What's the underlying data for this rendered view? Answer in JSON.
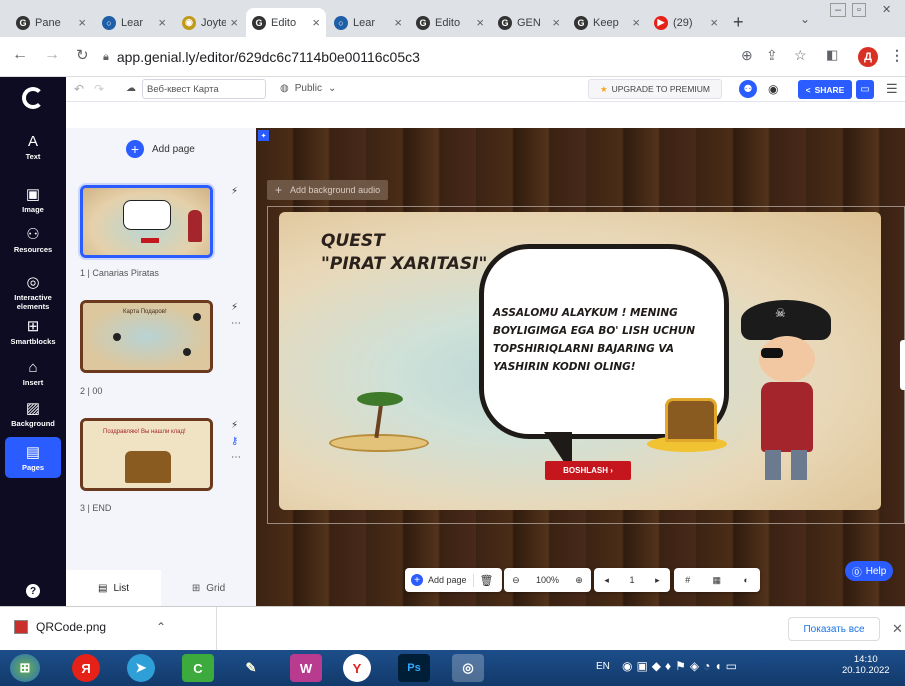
{
  "browser": {
    "tabs": [
      {
        "title": "Pane",
        "color": "#333333",
        "glyph": "G"
      },
      {
        "title": "Lear",
        "color": "#1f5fa8",
        "glyph": "○"
      },
      {
        "title": "Joyte",
        "color": "#c29a1a",
        "glyph": "◉"
      },
      {
        "title": "Edito",
        "color": "#333333",
        "glyph": "G",
        "active": true
      },
      {
        "title": "Lear",
        "color": "#1f5fa8",
        "glyph": "○"
      },
      {
        "title": "Edito",
        "color": "#333333",
        "glyph": "G"
      },
      {
        "title": "GEN",
        "color": "#333333",
        "glyph": "G"
      },
      {
        "title": "Keep",
        "color": "#333333",
        "glyph": "G"
      },
      {
        "title": "(29)",
        "color": "#e62117",
        "glyph": "▶"
      }
    ],
    "url": "app.genial.ly/editor/629dc6c7114b0e00116c05c3",
    "profile_initial": "Д"
  },
  "editor": {
    "title_input": "Веб-квест Карта",
    "visibility": "Public",
    "upgrade_label": "UPGRADE TO PREMIUM",
    "share_label": "SHARE"
  },
  "sidebar": {
    "items": [
      {
        "label": "Text",
        "icon": "A"
      },
      {
        "label": "Image",
        "icon": "▣"
      },
      {
        "label": "Resources",
        "icon": "⚇"
      },
      {
        "label": "Interactive elements",
        "icon": "◎"
      },
      {
        "label": "Smartblocks",
        "icon": "⊞"
      },
      {
        "label": "Insert",
        "icon": "⌂"
      },
      {
        "label": "Background",
        "icon": "▨"
      },
      {
        "label": "Pages",
        "icon": "▤"
      }
    ]
  },
  "pages_panel": {
    "add_page": "Add page",
    "pages": [
      {
        "label": "1 | Canarias Piratas",
        "thumb_title": "Quest \"Pirat Xaritasi\""
      },
      {
        "label": "2 | 00",
        "thumb_title": "Карта Подаров!"
      },
      {
        "label": "3 | END",
        "thumb_title": "Поздравляю! Вы нашли клад!"
      }
    ],
    "view_list": "List",
    "view_grid": "Grid"
  },
  "canvas": {
    "bg_audio": "Add background audio",
    "quest_line1": "QUEST",
    "quest_line2": "\"PIRAT XARITASI\"",
    "bubble_text": "ASSALOMU ALAYKUM ! MENING BOYLIGIMGA EGA BO' LISH UCHUN TOPSHIRIQLARNI BAJARING VA YASHIRIN KODNI OLING!",
    "start_button": "BOSHLASH ›"
  },
  "bottom_toolbar": {
    "add_page": "Add page",
    "zoom": "100%",
    "page_num": "1"
  },
  "help_label": "Help",
  "downloads": {
    "file_name": "QRCode.png",
    "show_all": "Показать все"
  },
  "taskbar": {
    "lang": "EN",
    "time": "14:10",
    "date": "20.10.2022"
  }
}
